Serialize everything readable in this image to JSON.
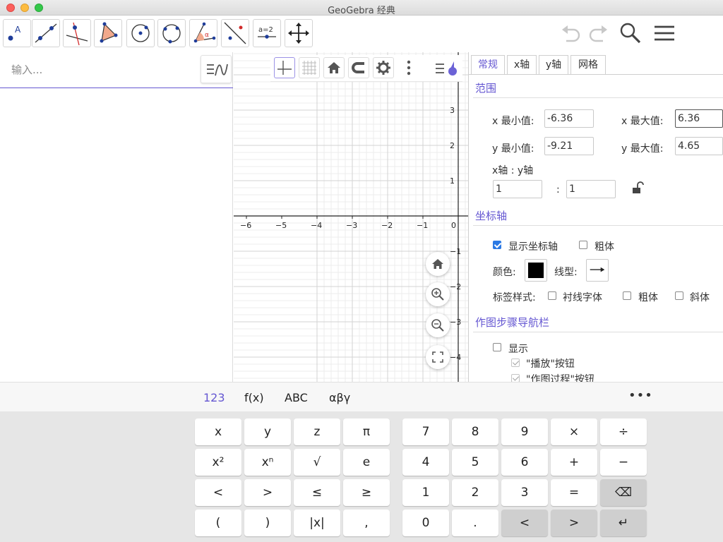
{
  "window": {
    "title": "GeoGebra 经典"
  },
  "algebra": {
    "input_placeholder": "输入..."
  },
  "graphics": {
    "x_ticks": [
      "−6",
      "−5",
      "−4",
      "−3",
      "−2",
      "−1",
      "0"
    ],
    "y_ticks_pos": [
      "3",
      "2",
      "1"
    ],
    "y_ticks_neg": [
      "−1",
      "−2",
      "−3",
      "−4"
    ]
  },
  "properties": {
    "tabs": [
      "常规",
      "x轴",
      "y轴",
      "网格"
    ],
    "range_title": "范围",
    "xmin_label": "x 最小值:",
    "xmin_value": "-6.36",
    "xmax_label": "x 最大值:",
    "xmax_value": "6.36",
    "ymin_label": "y 最小值:",
    "ymin_value": "-9.21",
    "ymax_label": "y 最大值:",
    "ymax_value": "4.65",
    "ratio_label": "x轴 : y轴",
    "ratio_x": "1",
    "ratio_sep": ":",
    "ratio_y": "1",
    "axes_title": "坐标轴",
    "show_axes_label": "显示坐标轴",
    "show_axes_checked": true,
    "bold_label": "粗体",
    "color_label": "颜色:",
    "axis_color": "#000000",
    "line_style_label": "线型:",
    "label_style_label": "标签样式:",
    "serif_label": "衬线字体",
    "bold2_label": "粗体",
    "italic_label": "斜体",
    "nav_title": "作图步骤导航栏",
    "nav_show_label": "显示",
    "nav_play_label": "\"播放\"按钮",
    "nav_cons_label": "\"作图过程\"按钮"
  },
  "keyboard": {
    "tabs": [
      "123",
      "f(x)",
      "ABC",
      "αβγ"
    ],
    "more": "•••",
    "left_keys": [
      [
        "x",
        "y",
        "z",
        "π"
      ],
      [
        "x²",
        "xⁿ",
        "√",
        "e"
      ],
      [
        "<",
        ">",
        "≤",
        "≥"
      ],
      [
        "(",
        ")",
        "|x|",
        ","
      ]
    ],
    "right_keys": [
      [
        "7",
        "8",
        "9",
        "×",
        "÷"
      ],
      [
        "4",
        "5",
        "6",
        "+",
        "−"
      ],
      [
        "1",
        "2",
        "3",
        "=",
        "⌫"
      ],
      [
        "0",
        ".",
        "<",
        ">",
        "↵"
      ]
    ]
  }
}
